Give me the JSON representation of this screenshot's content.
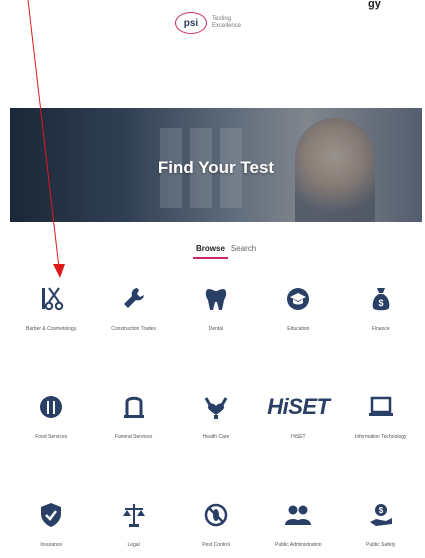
{
  "header": {
    "top_fragment": "gy",
    "logo_text": "psi",
    "logo_tagline_1": "Testing",
    "logo_tagline_2": "Excellence"
  },
  "hero": {
    "title": "Find Your Test"
  },
  "tabs": [
    {
      "label": "Browse",
      "active": true
    },
    {
      "label": "Search",
      "active": false
    }
  ],
  "categories": [
    {
      "label": "Barber & Cosmetology",
      "icon": "scissors-icon"
    },
    {
      "label": "Construction Trades",
      "icon": "wrench-icon"
    },
    {
      "label": "Dental",
      "icon": "tooth-icon"
    },
    {
      "label": "Education",
      "icon": "graduation-cap-icon"
    },
    {
      "label": "Finance",
      "icon": "money-bag-icon"
    },
    {
      "label": "Food Services",
      "icon": "food-icon"
    },
    {
      "label": "Funeral Services",
      "icon": "monument-icon"
    },
    {
      "label": "Health Care",
      "icon": "heart-hand-icon"
    },
    {
      "label": "HiSET",
      "icon": "hiset-logo"
    },
    {
      "label": "Information Technology",
      "icon": "laptop-icon"
    },
    {
      "label": "Insurance",
      "icon": "shield-check-icon"
    },
    {
      "label": "Legal",
      "icon": "scales-icon"
    },
    {
      "label": "Pest Control",
      "icon": "no-pest-icon"
    },
    {
      "label": "Public Administration",
      "icon": "people-icon"
    },
    {
      "label": "Public Safety",
      "icon": "safety-hand-icon"
    }
  ],
  "hiset_logo_text": "HiSET",
  "colors": {
    "accent": "#c8286a",
    "icon": "#2a3f66",
    "annotation": "#e01818"
  }
}
